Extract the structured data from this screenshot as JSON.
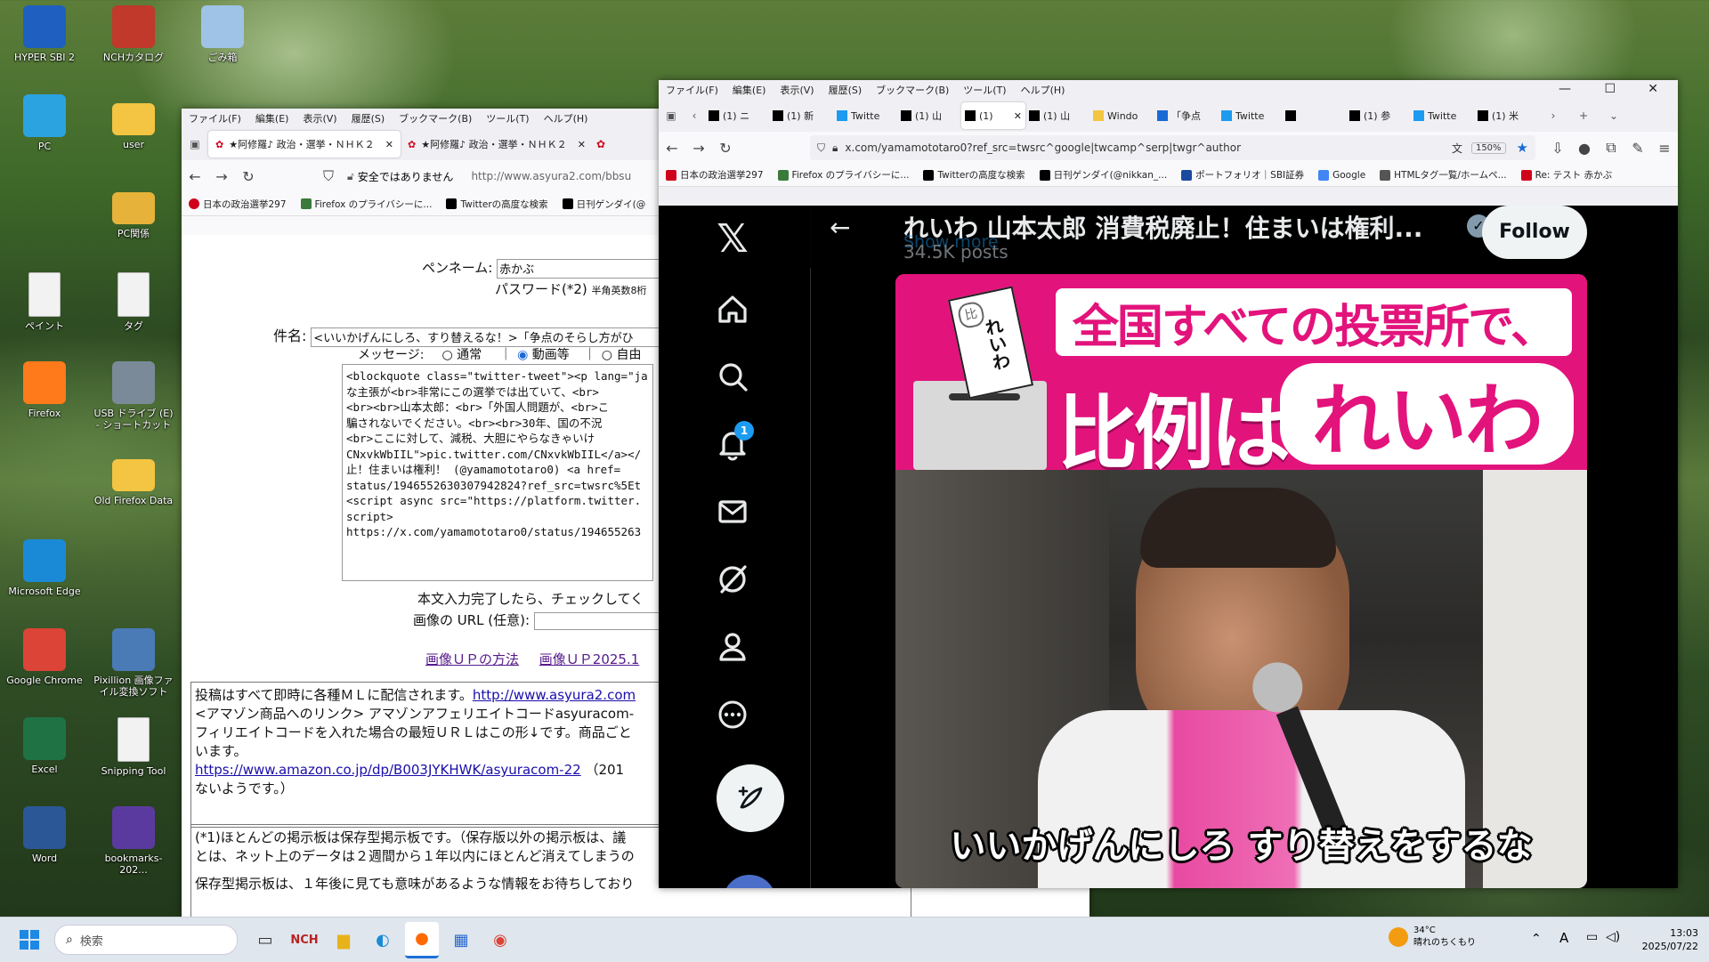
{
  "desktop": {
    "icons": [
      {
        "label": "HYPER SBI 2",
        "icon": "lightning-icon",
        "color": "#1e5fbf"
      },
      {
        "label": "NCHカタログ",
        "icon": "nch-catalog-icon",
        "color": "#c0392b"
      },
      {
        "label": "ごみ箱",
        "icon": "recycle-bin-icon",
        "color": "#9fc3e6"
      },
      {
        "label": "PC",
        "icon": "monitor-icon",
        "color": "#2aa3e0"
      },
      {
        "label": "user",
        "icon": "folder-icon",
        "color": "#f4c542"
      },
      {
        "label": "PC関係",
        "icon": "folder-icon",
        "color": "#e6b23a"
      },
      {
        "label": "ペイント",
        "icon": "document-icon",
        "color": "#f2f2f2"
      },
      {
        "label": "タグ",
        "icon": "document-icon",
        "color": "#f2f2f2"
      },
      {
        "label": "Firefox",
        "icon": "firefox-icon",
        "color": "#ff7a1a"
      },
      {
        "label": "USB ドライブ (E) - ショートカット",
        "icon": "usb-drive-icon",
        "color": "#7a8a99"
      },
      {
        "label": "Old Firefox Data",
        "icon": "folder-icon",
        "color": "#f4c542"
      },
      {
        "label": "Microsoft Edge",
        "icon": "edge-icon",
        "color": "#1b8ad6"
      },
      {
        "label": "Google Chrome",
        "icon": "chrome-icon",
        "color": "#db4437"
      },
      {
        "label": "Pixillion 画像ファイル変換ソフト",
        "icon": "pixillion-icon",
        "color": "#4a7bb7"
      },
      {
        "label": "Excel",
        "icon": "excel-icon",
        "color": "#1f7244"
      },
      {
        "label": "Snipping Tool",
        "icon": "document-icon",
        "color": "#f2f2f2"
      },
      {
        "label": "Word",
        "icon": "word-icon",
        "color": "#2b5797"
      },
      {
        "label": "bookmarks-202...",
        "icon": "firefox-file-icon",
        "color": "#5b3aa0"
      }
    ]
  },
  "left_window": {
    "menu": [
      "ファイル(F)",
      "編集(E)",
      "表示(V)",
      "履歴(S)",
      "ブックマーク(B)",
      "ツール(T)",
      "ヘルプ(H)"
    ],
    "tabs": [
      "★阿修羅♪ 政治・選挙・ＮＨＫ２",
      "★阿修羅♪ 政治・選挙・ＮＨＫ２"
    ],
    "security_label": "安全ではありません",
    "url": "http://www.asyura2.com/bbsu",
    "bookmarks": [
      "日本の政治選挙297",
      "Firefox のプライバシーに...",
      "Twitterの高度な検索",
      "日刊ゲンダイ(@"
    ],
    "form": {
      "penname_label": "ペンネーム:",
      "penname_value": "赤かぶ",
      "password_label": "パスワード(*2)",
      "password_hint": "半角英数8桁",
      "subject_label": "件名:",
      "subject_value": "<いいかげんにしろ、すり替えるな！>「争点のそらし方がひ",
      "message_label": "メッセージ:",
      "radio_normal": "通常",
      "radio_video": "動画等",
      "radio_free": "自由",
      "body_lines": [
        "<blockquote class=\"twitter-tweet\"><p lang=\"ja",
        "な主張が<br>非常にこの選挙では出ていて、<br>",
        "<br><br>山本太郎：<br>「外国人問題が、<br>こ",
        "騙されないでください。<br><br>30年、国の不況",
        "<br>ここに対して、減税、大胆にやらなきゃいけ",
        "CNxvkWbIIL\">pic.twitter.com/CNxvkWbIIL</a></",
        "止！住まいは権利！ (@yamamototaro0) <a href=",
        "status/1946552630307942824?ref_src=twsrc%5Et",
        "<script async src=\"https://platform.twitter.",
        "script>",
        "https://x.com/yamamototaro0/status/194655263"
      ],
      "check_text": "本文入力完了したら、チェックしてく",
      "image_url_label": "画像の URL (任意):",
      "link_upload_method": "画像ＵＰの方法",
      "link_upload_2025": "画像ＵＰ2025.1"
    },
    "notice": {
      "line1_text": "投稿はすべて即時に各種ＭＬに配信されます。",
      "line1_link": "http://www.asyura2.com",
      "line2": "<アマゾン商品へのリンク> アマゾンアフェリエイトコードasyuracom-",
      "line3": "フィリエイトコードを入れた場合の最短ＵＲＬはこの形↓です。商品ごと",
      "line4": "います。",
      "line5_link": "https://www.amazon.co.jp/dp/B003JYKHWK/asyuracom-22",
      "line5_text": "（201",
      "line6": "ないようです。）"
    },
    "notice2": {
      "line1": "(*1)ほとんどの掲示板は保存型掲示板です。（保存版以外の掲示板は、議",
      "line2": "とは、ネット上のデータは２週間から１年以内にほとんど消えてしまうの",
      "line3": "保存型掲示板は、１年後に見ても意味があるような情報をお待ちしており"
    }
  },
  "right_window": {
    "menu": [
      "ファイル(F)",
      "編集(E)",
      "表示(V)",
      "履歴(S)",
      "ブックマーク(B)",
      "ツール(T)",
      "ヘルプ(H)"
    ],
    "tabs": [
      "(1) ニ",
      "(1) 新",
      "Twitte",
      "(1) 山",
      "(1)",
      "(1) 山",
      "Windo",
      "「争点",
      "Twitte",
      "",
      "(1) 参",
      "Twitte",
      "(1) 米"
    ],
    "url": "x.com/yamamototaro0?ref_src=twsrc^google|twcamp^serp|twgr^author",
    "zoom": "150%",
    "bookmarks": [
      "日本の政治選挙297",
      "Firefox のプライバシーに...",
      "Twitterの高度な検索",
      "日刊ゲンダイ(@nikkan_...",
      "ポートフォリオ｜SBI証券",
      "Google",
      "HTMLタグ一覧/ホームペ...",
      "Re: テスト 赤かぶ"
    ],
    "x": {
      "profile_name": "れいわ 山本太郎 消費税廃止！住まいは権利...",
      "posts_count": "34.5K posts",
      "show_more": "Show more",
      "follow_label": "Follow",
      "notification_badge": "1",
      "media": {
        "ballot_text": "れいわ",
        "ballot_mark": "比",
        "headline_top": "全国すべての投票所で、",
        "headline_left": "比例は",
        "headline_right": "れいわ",
        "caption": "いいかげんにしろ すり替えをするな"
      }
    }
  },
  "taskbar": {
    "search_placeholder": "検索",
    "weather_temp": "34°C",
    "weather_desc": "晴れのちくもり",
    "ime": "A",
    "time": "13:03",
    "date": "2025/07/22"
  }
}
